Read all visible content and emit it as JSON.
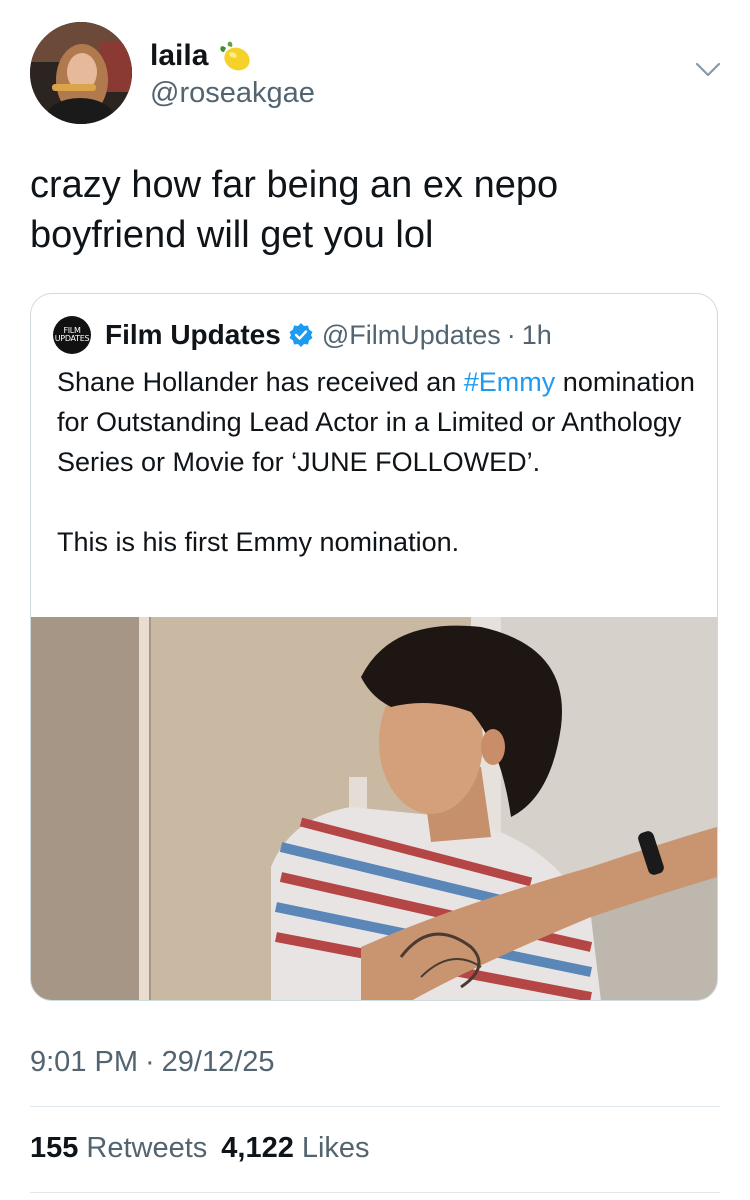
{
  "author": {
    "name": "laila",
    "handle": "@roseakgae",
    "emoji_icon": "lemon-icon"
  },
  "tweet": {
    "text": "crazy how far being an ex nepo\nboyfriend will get you lol"
  },
  "quoted": {
    "logo_lines": [
      "FILM",
      "UPDATES"
    ],
    "name": "Film Updates",
    "verified_icon": "verified-badge-icon",
    "handle": "@FilmUpdates",
    "dot": "·",
    "time": "1h",
    "text_before_hashtag": "Shane Hollander has received an ",
    "hashtag": "#Emmy",
    "text_after_hashtag": " nomination for Outstanding Lead Actor in a Limited or Anthology Series or Movie for ‘JUNE FOLLOWED’.",
    "second_paragraph": "This is his first Emmy nomination.",
    "media_icon": "photo-of-actor"
  },
  "meta": {
    "time": "9:01 PM",
    "dot": "·",
    "date": "29/12/25"
  },
  "stats": {
    "retweets_count": "155",
    "retweets_label": "Retweets",
    "likes_count": "4,122",
    "likes_label": "Likes"
  },
  "colors": {
    "link": "#1d9bf0",
    "secondary_text": "#536471",
    "border": "#cfd9de"
  }
}
